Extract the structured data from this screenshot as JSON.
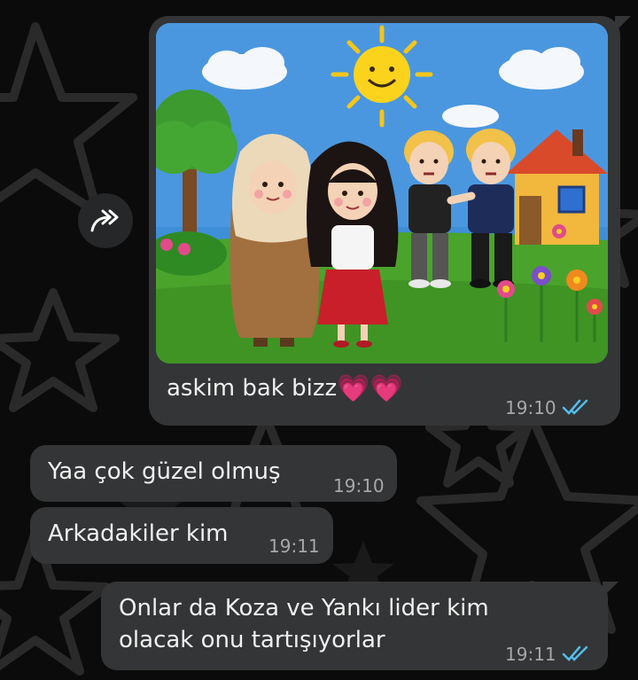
{
  "messages": [
    {
      "id": "sent-image",
      "direction": "outgoing",
      "type": "image",
      "caption_text": "askim bak bizz",
      "caption_emoji": "💗💗",
      "time": "19:10",
      "status": "read"
    },
    {
      "id": "received-1",
      "direction": "incoming",
      "text": "Yaa çok güzel olmuş",
      "time": "19:10"
    },
    {
      "id": "received-2",
      "direction": "incoming",
      "text": "Arkadakiler kim",
      "time": "19:11"
    },
    {
      "id": "sent-2",
      "direction": "outgoing",
      "text_line1": "Onlar da Koza ve Yankı lider kim",
      "text_line2": "olacak onu tartışıyorlar",
      "time": "19:11",
      "status": "read"
    }
  ],
  "icons": {
    "forward": "forward-arrow-icon",
    "read_receipt": "double-check-icon"
  },
  "colors": {
    "bubble": "#343536",
    "read_tick": "#53bdeb",
    "background": "#0b0b0b"
  }
}
